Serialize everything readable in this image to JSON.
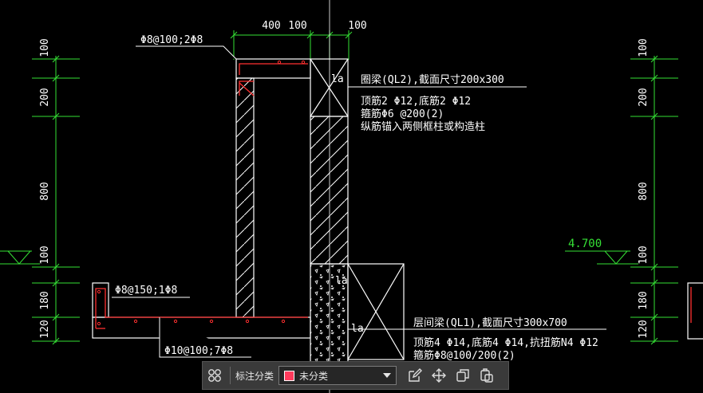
{
  "drawing": {
    "dim_top": [
      "400",
      "100",
      "100"
    ],
    "dim_side": [
      "100",
      "200",
      "800",
      "100",
      "180",
      "120"
    ],
    "level": "4.700",
    "ann_rebar_top": "Φ8@100;2Φ8",
    "ann_rebar_mid": "Φ8@150;1Φ8",
    "ann_rebar_bottom": "Φ10@100;7Φ8",
    "ql2": {
      "title": "圈梁(QL2),截面尺寸200x300",
      "line1": "顶筋2 Φ12,底筋2 Φ12",
      "line2": "箍筋Φ6 @200(2)",
      "line3": "纵筋锚入两侧框柱或构造柱"
    },
    "ql1": {
      "title": "层间梁(QL1),截面尺寸300x700",
      "line1": "顶筋4 Φ14,底筋4 Φ14,抗扭筋N4 Φ12",
      "line2": "箍筋Φ8@100/200(2)"
    },
    "la_labels": [
      "la",
      "la",
      "la"
    ]
  },
  "toolbar": {
    "category_label": "标注分类",
    "category_value": "未分类",
    "category_color": "#ff3b5c",
    "icons": [
      "layout-icon",
      "edit-icon",
      "move-icon",
      "copy-icon",
      "paste-icon"
    ]
  },
  "colors": {
    "dim": "#35e035",
    "rebar": "#ff3030",
    "line": "#ffffff"
  }
}
